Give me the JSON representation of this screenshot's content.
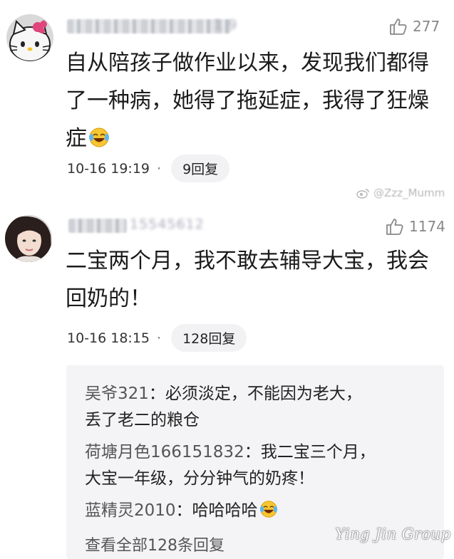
{
  "comments": [
    {
      "username": "1 9",
      "likes": "277",
      "avatar": "hello-kitty-avatar",
      "lines": [
        "自从陪孩子做作业以来，发现我们都得",
        "了一种病，她得了拖延症，我得了狂燥",
        "症"
      ],
      "emoji": "laugh-cry-emoji",
      "time": "10-16 19:19",
      "separator": "·",
      "replies_label": "9回复"
    },
    {
      "username": "15545612",
      "likes": "1174",
      "avatar": "woman-portrait-avatar",
      "lines": [
        "二宝两个月，我不敢去辅导大宝，我会",
        "回奶的！"
      ],
      "time": "10-16 18:15",
      "separator": "·",
      "replies_label": "128回复"
    }
  ],
  "watermark": {
    "icon": "weibo-icon",
    "handle": "@Zzz_Mumm"
  },
  "replies": [
    {
      "who": "吴爷321",
      "sep": "：",
      "text": "必须淡定，不能因为老大，",
      "cont": "丢了老二的粮仓"
    },
    {
      "who": "荷塘月色166151832",
      "sep": "：",
      "text": "我二宝三个月，",
      "cont": "大宝一年级，分分钟气的奶疼！"
    },
    {
      "who": "蓝精灵2010",
      "sep": "：",
      "text": "哈哈哈哈",
      "emoji": "laugh-cry-emoji"
    }
  ],
  "see_all": "查看全部128条回复",
  "brand": "Ying Jin Group",
  "colors": {
    "background": "#ffffff",
    "reply_panel": "#f4f4f6",
    "muted_text": "#888888"
  }
}
